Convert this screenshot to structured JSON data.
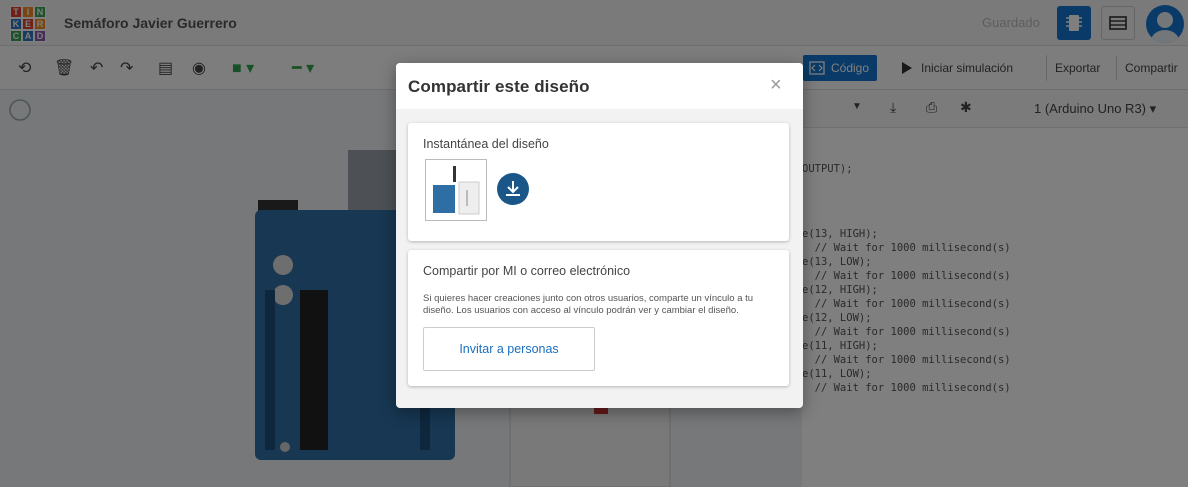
{
  "header": {
    "logo_letters": [
      "T",
      "I",
      "N",
      "K",
      "E",
      "R",
      "C",
      "A",
      "D"
    ],
    "logo_colors": [
      "#e2412e",
      "#f28c22",
      "#3aa757",
      "#2f79c0",
      "#e2412e",
      "#f28c22",
      "#3aa757",
      "#2f79c0",
      "#8a5bb0"
    ],
    "title": "Semáforo Javier Guerrero",
    "saved_status": "Guardado"
  },
  "toolbar": {
    "code_label": "Código",
    "simulate_label": "Iniciar simulación",
    "export_label": "Exportar",
    "share_label": "Compartir"
  },
  "code_panel": {
    "board_selector": "1 (Arduino Uno R3)",
    "lines": [
      "OUTPUT);",
      "e(13, HIGH);",
      "  // Wait for 1000 millisecond(s)",
      "e(13, LOW);",
      "  // Wait for 1000 millisecond(s)",
      "e(12, HIGH);",
      "  // Wait for 1000 millisecond(s)",
      "e(12, LOW);",
      "  // Wait for 1000 millisecond(s)",
      "e(11, HIGH);",
      "  // Wait for 1000 millisecond(s)",
      "e(11, LOW);",
      "  // Wait for 1000 millisecond(s)"
    ]
  },
  "modal": {
    "title": "Compartir este diseño",
    "close_symbol": "×",
    "snapshot": {
      "title": "Instantánea del diseño"
    },
    "share": {
      "title": "Compartir por MI o correo electrónico",
      "description": "Si quieres hacer creaciones junto con otros usuarios, comparte un vínculo a tu diseño. Los usuarios con acceso al vínculo podrán ver y cambiar el diseño.",
      "invite_button": "Invitar a personas"
    }
  },
  "colors": {
    "accent": "#1477d1",
    "download_button": "#1a5788",
    "link_text": "#1a6fbf",
    "arduino_board": "#2f6ea5"
  }
}
